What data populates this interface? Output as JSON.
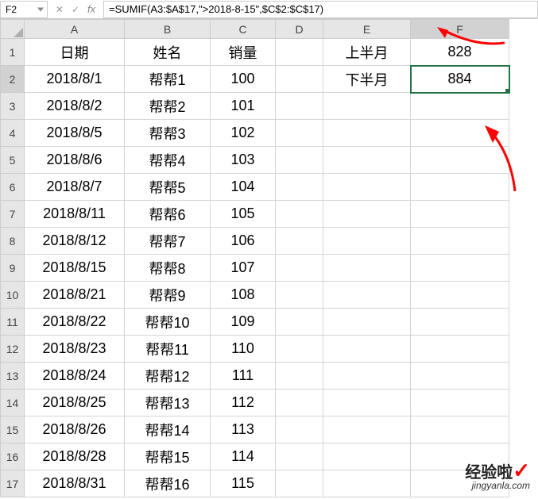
{
  "name_box": "F2",
  "formula": "=SUMIF(A3:$A$17,\">2018-8-15\",$C$2:$C$17)",
  "columns": [
    "A",
    "B",
    "C",
    "D",
    "E",
    "F"
  ],
  "rows": [
    1,
    2,
    3,
    4,
    5,
    6,
    7,
    8,
    9,
    10,
    11,
    12,
    13,
    14,
    15,
    16,
    17
  ],
  "active": {
    "row": 2,
    "col": "F"
  },
  "headers": {
    "A": "日期",
    "B": "姓名",
    "C": "销量",
    "E": "上半月",
    "F": "828"
  },
  "row2_extra": {
    "E": "下半月",
    "F": "884"
  },
  "table": [
    {
      "date": "2018/8/1",
      "name": "帮帮1",
      "sales": "100"
    },
    {
      "date": "2018/8/2",
      "name": "帮帮2",
      "sales": "101"
    },
    {
      "date": "2018/8/5",
      "name": "帮帮3",
      "sales": "102"
    },
    {
      "date": "2018/8/6",
      "name": "帮帮4",
      "sales": "103"
    },
    {
      "date": "2018/8/7",
      "name": "帮帮5",
      "sales": "104"
    },
    {
      "date": "2018/8/11",
      "name": "帮帮6",
      "sales": "105"
    },
    {
      "date": "2018/8/12",
      "name": "帮帮7",
      "sales": "106"
    },
    {
      "date": "2018/8/15",
      "name": "帮帮8",
      "sales": "107"
    },
    {
      "date": "2018/8/21",
      "name": "帮帮9",
      "sales": "108"
    },
    {
      "date": "2018/8/22",
      "name": "帮帮10",
      "sales": "109"
    },
    {
      "date": "2018/8/23",
      "name": "帮帮11",
      "sales": "110"
    },
    {
      "date": "2018/8/24",
      "name": "帮帮12",
      "sales": "111"
    },
    {
      "date": "2018/8/25",
      "name": "帮帮13",
      "sales": "112"
    },
    {
      "date": "2018/8/26",
      "name": "帮帮14",
      "sales": "113"
    },
    {
      "date": "2018/8/28",
      "name": "帮帮15",
      "sales": "114"
    },
    {
      "date": "2018/8/31",
      "name": "帮帮16",
      "sales": "115"
    }
  ],
  "watermark": {
    "main": "经验啦",
    "check": "✓",
    "sub": "jingyanla.com"
  },
  "fx_label": "fx",
  "cancel_icon": "✕",
  "enter_icon": "✓"
}
